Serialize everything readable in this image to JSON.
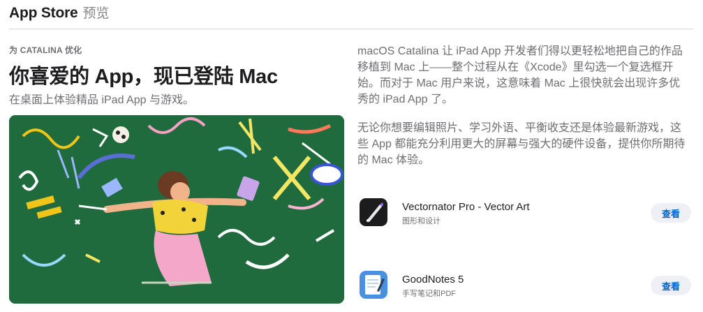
{
  "header": {
    "brand": "App Store",
    "preview_label": "预览"
  },
  "story": {
    "eyebrow": "为 CATALINA 优化",
    "headline": "你喜爱的 App，现已登陆 Mac",
    "subheadline": "在桌面上体验精品 iPad App 与游戏。"
  },
  "description": {
    "paragraph1": "macOS Catalina 让 iPad App 开发者们得以更轻松地把自己的作品移植到 Mac 上——整个过程从在《Xcode》里勾选一个复选框开始。而对于 Mac 用户来说，这意味着 Mac 上很快就会出现许多优秀的 iPad App 了。",
    "paragraph2": "无论你想要编辑照片、学习外语、平衡收支还是体验最新游戏，这些 App 都能充分利用更大的屏幕与强大的硬件设备，提供你所期待的 Mac 体验。"
  },
  "apps": [
    {
      "name": "Vectornator Pro - Vector Art",
      "category": "图形和设计",
      "button": "查看",
      "icon": "vectornator-app-icon"
    },
    {
      "name": "GoodNotes 5",
      "category": "手写笔记和PDF",
      "button": "查看",
      "icon": "goodnotes-app-icon"
    }
  ],
  "colors": {
    "accent": "#0066cc",
    "hero_bg": "#1f6b3d",
    "button_bg": "#eef0f5"
  }
}
